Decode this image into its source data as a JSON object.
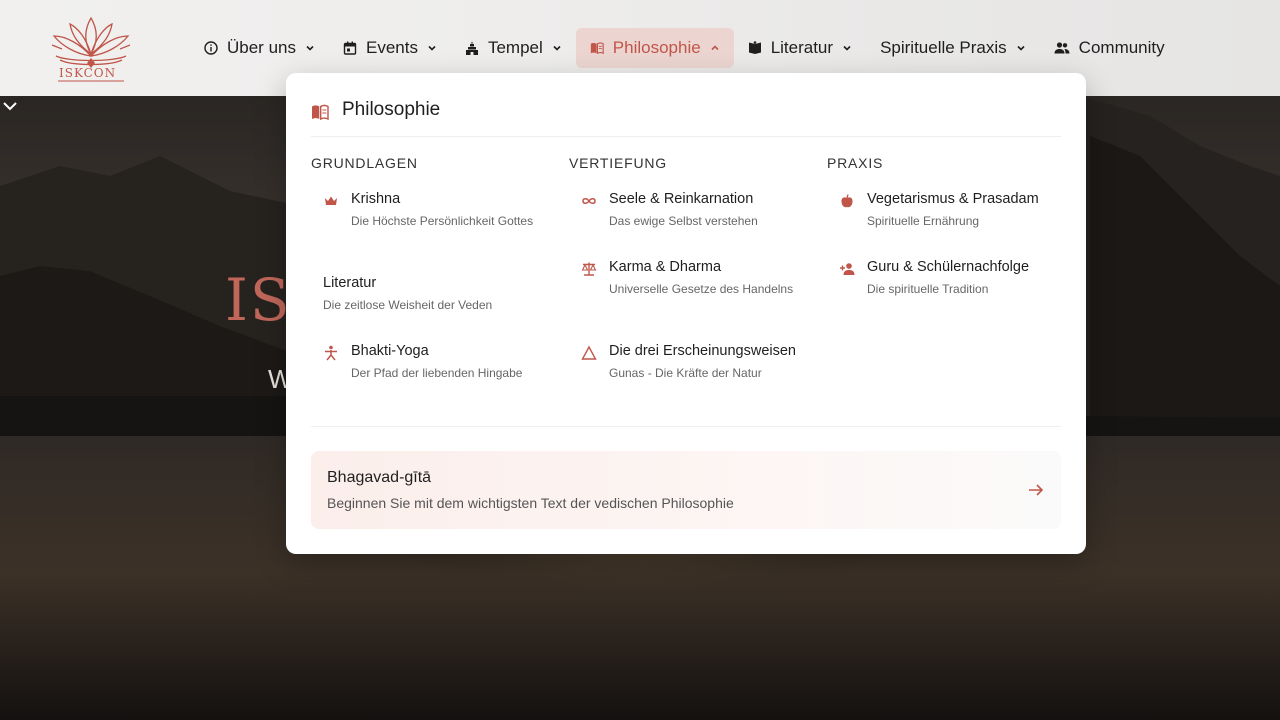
{
  "brand": {
    "name": "ISKCON",
    "accent": "#c0564a"
  },
  "nav": {
    "items": [
      {
        "label": "Über uns",
        "icon": "info-circle-icon"
      },
      {
        "label": "Events",
        "icon": "calendar-icon"
      },
      {
        "label": "Tempel",
        "icon": "temple-icon"
      },
      {
        "label": "Philosophie",
        "icon": "open-book-icon",
        "active": true
      },
      {
        "label": "Literatur",
        "icon": "book-icon"
      },
      {
        "label": "Spirituelle Praxis",
        "icon": ""
      },
      {
        "label": "Community",
        "icon": "people-icon"
      }
    ]
  },
  "dropdown": {
    "title": "Philosophie",
    "columns": [
      {
        "title": "Grundlagen",
        "entries": [
          {
            "title": "Krishna",
            "desc": "Die Höchste Persönlichkeit Gottes",
            "icon": "crown-icon"
          },
          {
            "title": "Literatur",
            "desc": "Die zeitlose Weisheit der Veden",
            "icon": ""
          },
          {
            "title": "Bhakti-Yoga",
            "desc": "Der Pfad der liebenden Hingabe",
            "icon": "meditation-figure-icon"
          }
        ]
      },
      {
        "title": "Vertiefung",
        "entries": [
          {
            "title": "Seele & Reinkarnation",
            "desc": "Das ewige Selbst verstehen",
            "icon": "infinity-icon"
          },
          {
            "title": "Karma & Dharma",
            "desc": "Universelle Gesetze des Handelns",
            "icon": "scale-icon"
          },
          {
            "title": "Die drei Erscheinungsweisen",
            "desc": "Gunas - Die Kräfte der Natur",
            "icon": "triangle-icon"
          }
        ]
      },
      {
        "title": "Praxis",
        "entries": [
          {
            "title": "Vegetarismus & Prasadam",
            "desc": "Spirituelle Ernährung",
            "icon": "apple-icon"
          },
          {
            "title": "Guru & Schülernachfolge",
            "desc": "Die spirituelle Tradition",
            "icon": "person-add-icon"
          }
        ]
      }
    ],
    "feature": {
      "title": "Bhagavad-gītā",
      "desc": "Beginnen Sie mit dem wichtigsten Text der vedischen Philosophie",
      "icon": "arrow-right-icon"
    }
  },
  "hero": {
    "title_visible": "IS",
    "subtitle_visible": "W",
    "scroll_icon": "chevron-down-icon"
  }
}
